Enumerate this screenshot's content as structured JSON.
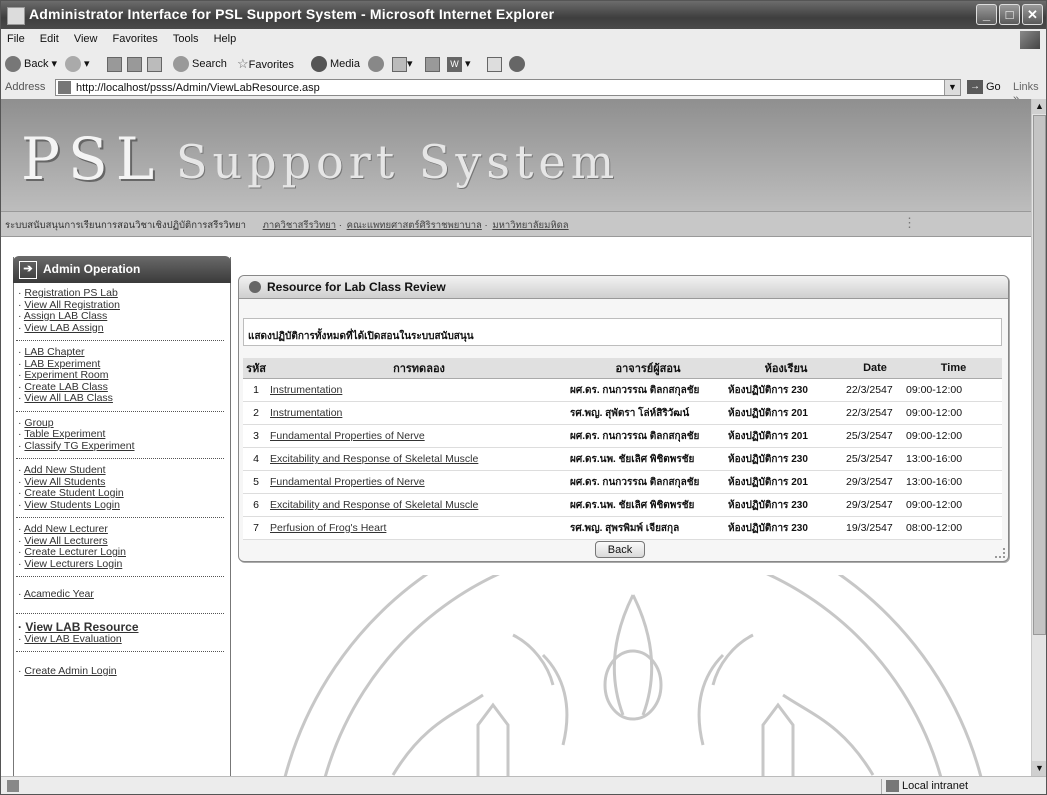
{
  "window": {
    "title": "Administrator Interface for PSL Support System - Microsoft Internet Explorer"
  },
  "menu": [
    "File",
    "Edit",
    "View",
    "Favorites",
    "Tools",
    "Help"
  ],
  "toolbar": {
    "back": "Back",
    "search": "Search",
    "favorites": "Favorites",
    "media": "Media"
  },
  "address": {
    "label": "Address",
    "url": "http://localhost/psss/Admin/ViewLabResource.asp",
    "go": "Go",
    "links": "Links"
  },
  "banner": {
    "logo": "PSL",
    "subtitle": "Support System",
    "tagline": "ระบบสนับสนุนการเรียนการสอนวิชาเชิงปฏิบัติการสรีรวิทยา",
    "links": [
      "ภาควิชาสรีรวิทยา",
      "คณะแพทยศาสตร์ศิริราชพยาบาล",
      "มหาวิทยาลัยมหิดล"
    ]
  },
  "sidebar": {
    "header": "Admin Operation",
    "groups": [
      {
        "items": [
          "Registration PS Lab",
          "View All Registration",
          "Assign LAB Class",
          "View LAB Assign"
        ]
      },
      {
        "items": [
          "LAB Chapter",
          "LAB Experiment",
          "Experiment Room",
          "Create LAB Class",
          "View All LAB Class"
        ]
      },
      {
        "items": [
          "Group",
          "Table Experiment",
          "Classify TG Experiment"
        ]
      },
      {
        "items": [
          "Add New Student",
          "View All Students",
          "Create Student Login",
          "View Students Login"
        ]
      },
      {
        "items": [
          "Add New Lecturer",
          "View All Lecturers",
          "Create Lecturer Login",
          "View Lecturers Login"
        ]
      },
      {
        "items": [
          "Acamedic Year"
        ]
      },
      {
        "items": [
          "View LAB Resource",
          "View LAB Evaluation"
        ]
      },
      {
        "items": [
          "Create Admin Login"
        ]
      }
    ]
  },
  "panel": {
    "title": "Resource for Lab Class Review",
    "description": "แสดงปฏิบัติการทั้งหมดที่ได้เปิดสอนในระบบสนับสนุน",
    "columns": [
      "รหัส",
      "การทดลอง",
      "อาจารย์ผู้สอน",
      "ห้องเรียน",
      "Date",
      "Time"
    ],
    "rows": [
      {
        "id": "1",
        "experiment": "Instrumentation",
        "lecturer": "ผศ.ดร. กนกวรรณ ติลกสกุลชัย",
        "room": "ห้องปฏิบัติการ 230",
        "date": "22/3/2547",
        "time": "09:00-12:00"
      },
      {
        "id": "2",
        "experiment": "Instrumentation",
        "lecturer": "รศ.พญ. สุพัตรา โล่ห์สิริวัฒน์",
        "room": "ห้องปฏิบัติการ 201",
        "date": "22/3/2547",
        "time": "09:00-12:00"
      },
      {
        "id": "3",
        "experiment": "Fundamental Properties of Nerve",
        "lecturer": "ผศ.ดร. กนกวรรณ ติลกสกุลชัย",
        "room": "ห้องปฏิบัติการ 201",
        "date": "25/3/2547",
        "time": "09:00-12:00"
      },
      {
        "id": "4",
        "experiment": "Excitability and Response of Skeletal Muscle",
        "lecturer": "ผศ.ดร.นพ. ชัยเลิศ พิชิตพรชัย",
        "room": "ห้องปฏิบัติการ 230",
        "date": "25/3/2547",
        "time": "13:00-16:00"
      },
      {
        "id": "5",
        "experiment": "Fundamental Properties of Nerve",
        "lecturer": "ผศ.ดร. กนกวรรณ ติลกสกุลชัย",
        "room": "ห้องปฏิบัติการ 201",
        "date": "29/3/2547",
        "time": "13:00-16:00"
      },
      {
        "id": "6",
        "experiment": "Excitability and Response of Skeletal Muscle",
        "lecturer": "ผศ.ดร.นพ. ชัยเลิศ พิชิตพรชัย",
        "room": "ห้องปฏิบัติการ 230",
        "date": "29/3/2547",
        "time": "09:00-12:00"
      },
      {
        "id": "7",
        "experiment": "Perfusion of Frog's Heart",
        "lecturer": "รศ.พญ. สุพรพิมพ์ เจียสกุล",
        "room": "ห้องปฏิบัติการ 230",
        "date": "19/3/2547",
        "time": "08:00-12:00"
      }
    ],
    "back_label": "Back"
  },
  "status": {
    "zone": "Local intranet"
  },
  "icons": {
    "back": "back-arrow-icon",
    "forward": "forward-arrow-icon",
    "stop": "stop-icon",
    "refresh": "refresh-icon",
    "home": "home-icon",
    "search": "search-icon",
    "favorites": "star-icon",
    "media": "media-icon",
    "history": "history-icon"
  }
}
